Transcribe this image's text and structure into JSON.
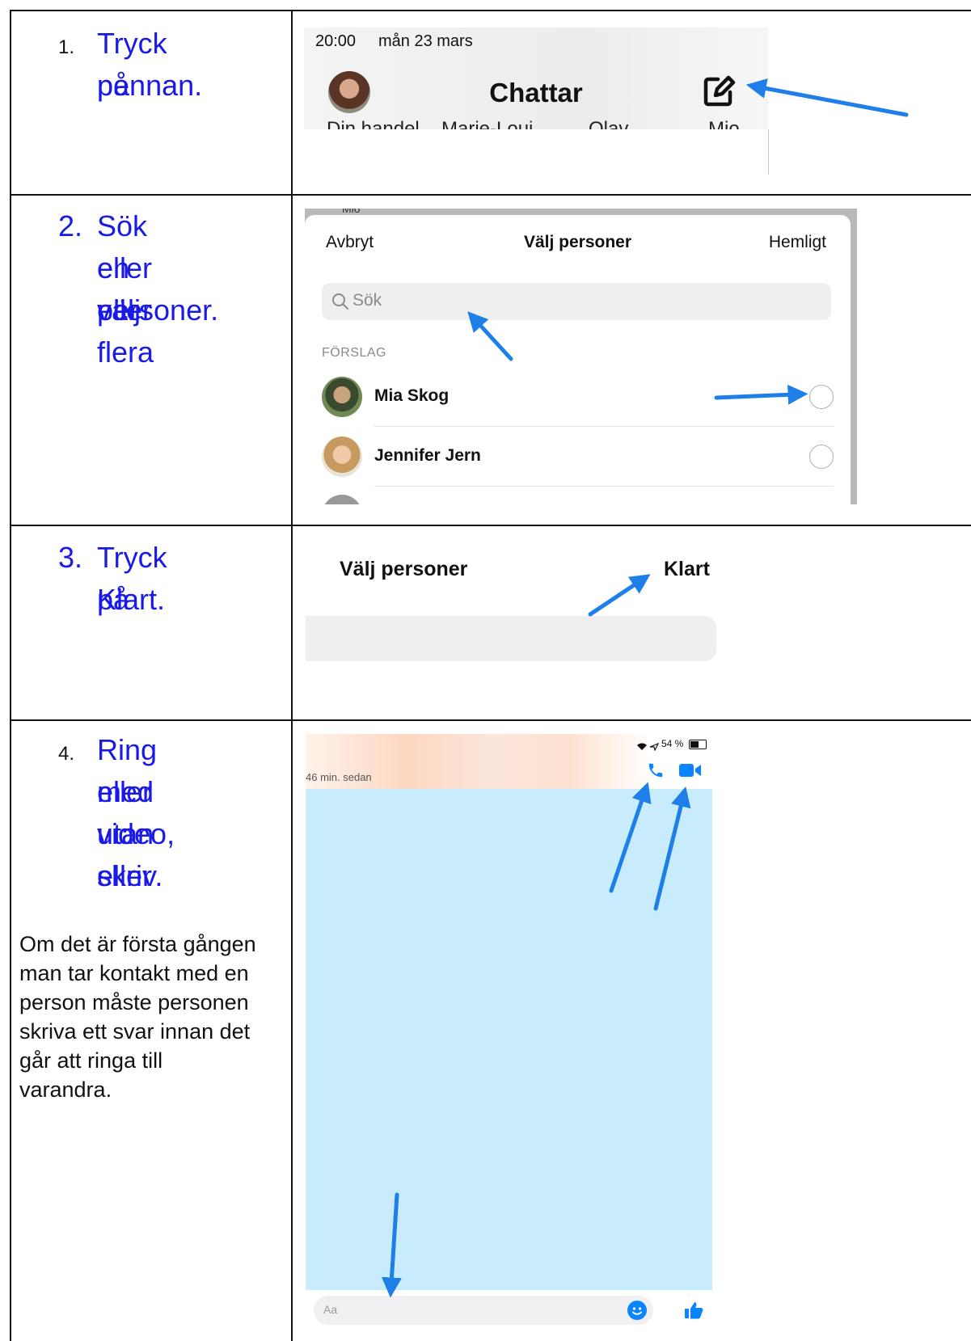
{
  "steps": [
    {
      "num": "1.",
      "lines": [
        "Tryck på",
        "pennan."
      ]
    },
    {
      "num": "2.",
      "lines": [
        "Sök eller välj",
        "en eller flera",
        "personer."
      ]
    },
    {
      "num": "3.",
      "lines": [
        "Tryck på",
        "Klart."
      ]
    },
    {
      "num": "4.",
      "lines": [
        "Ring med",
        "eller utan",
        "video, eller",
        "skriv."
      ]
    }
  ],
  "note": [
    "Om det är första gången",
    "man tar kontakt med en",
    "person måste personen",
    "skriva ett svar innan det",
    "går att ringa till",
    "varandra."
  ],
  "shot1": {
    "status_time": "20:00",
    "status_date": "mån 23 mars",
    "title": "Chattar",
    "cut_labels": [
      "Din handel...",
      "Marie-Loui...",
      "Olav",
      "Mio"
    ]
  },
  "shot2": {
    "cut_label": "Mio",
    "cancel": "Avbryt",
    "title": "Välj personer",
    "secret": "Hemligt",
    "search_placeholder": "Sök",
    "section": "FÖRSLAG",
    "contacts": [
      "Mia Skog",
      "Jennifer Jern"
    ]
  },
  "shot3": {
    "title": "Välj personer",
    "done": "Klart"
  },
  "shot4": {
    "status": "54 %",
    "last_seen": "46 min. sedan",
    "input_placeholder": "Aa"
  },
  "colors": {
    "step_text": "#1a1ae6",
    "arrow": "#1e7fe8",
    "messenger_blue": "#0a84ff",
    "chat_bg": "#c8ecfb"
  }
}
